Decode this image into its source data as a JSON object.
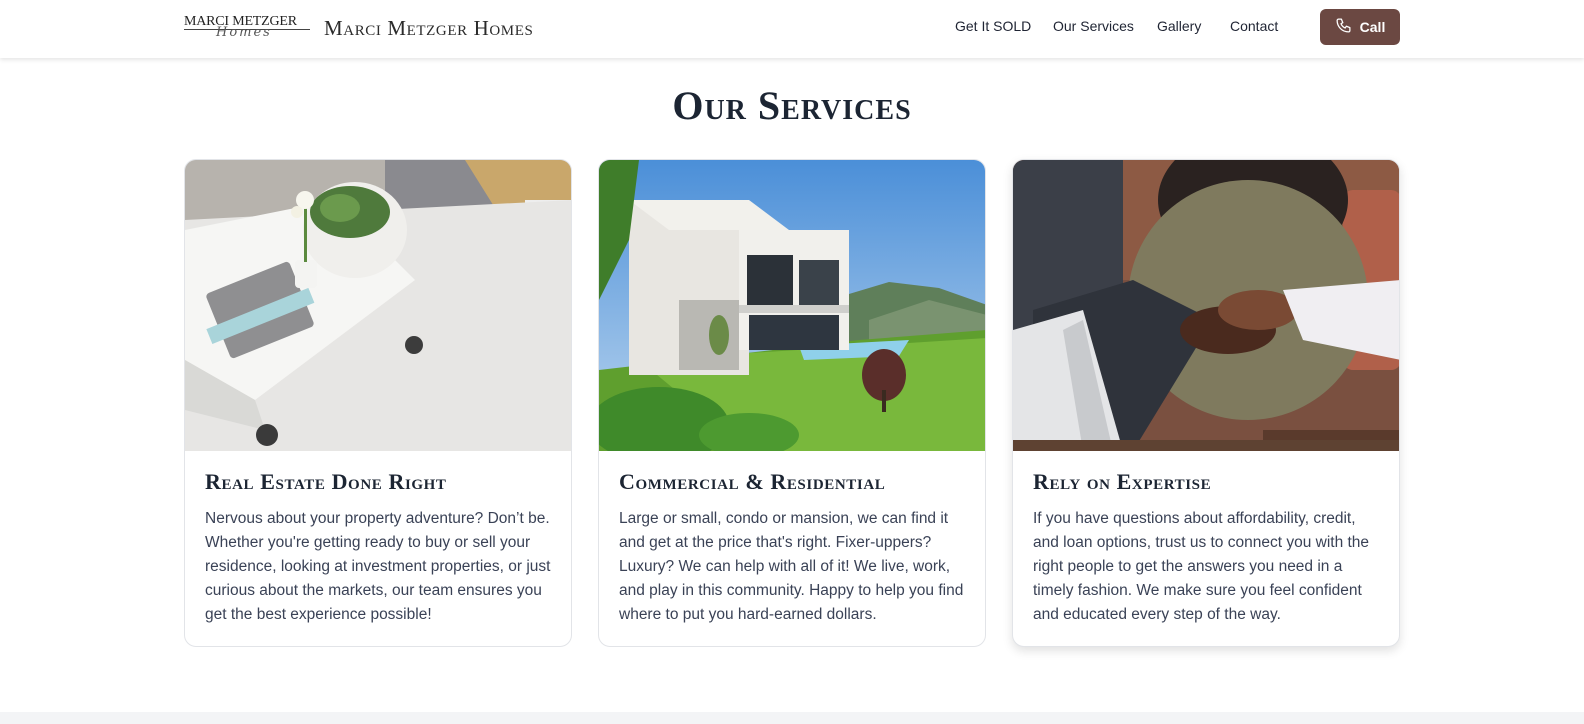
{
  "brand": {
    "logo_top": "MARCI METZGER",
    "logo_script": "Homes",
    "name": "Marci Metzger Homes"
  },
  "nav": {
    "items": [
      "Get It SOLD",
      "Our Services",
      "Gallery",
      "Contact"
    ],
    "call_label": "Call"
  },
  "section": {
    "title": "Our Services"
  },
  "cards": [
    {
      "title": "Real Estate Done Right",
      "text": "Nervous about your property adventure? Don’t be. Whether you're getting ready to buy or sell your residence, looking at investment properties, or just curious about the markets, our team ensures you get the best experience possible!",
      "image": "living-room-table-photo"
    },
    {
      "title": "Commercial & Residential",
      "text": "Large or small, condo or mansion, we can find it and get at the price that's right. Fixer-uppers? Luxury? We can help with all of it! We live, work, and play in this community. Happy to help you find where to put you hard-earned dollars.",
      "image": "modern-house-photo"
    },
    {
      "title": "Rely on Expertise",
      "text": "If you have questions about affordability, credit, and loan options, trust us to connect you with the right people to get the answers you need in a timely fashion. We make sure you feel confident and educated every step of the way.",
      "image": "handshake-photo"
    }
  ],
  "colors": {
    "accent": "#6b4842",
    "heading": "#1c2533",
    "body_text": "#3a4256"
  }
}
